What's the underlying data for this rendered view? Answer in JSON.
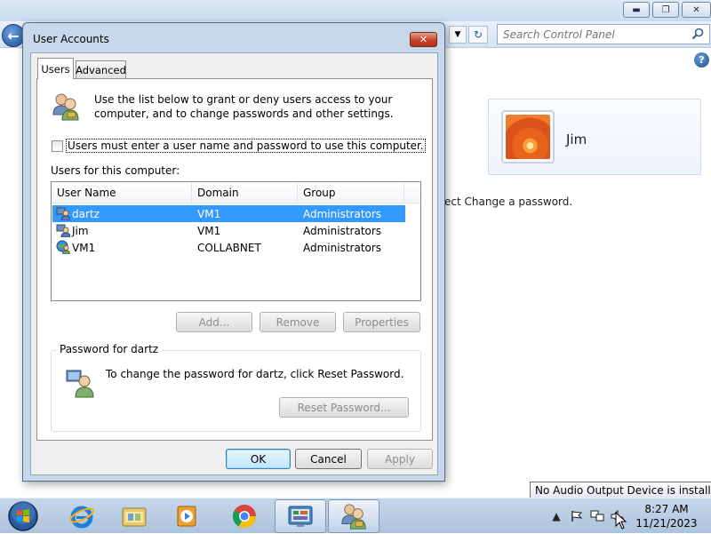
{
  "control_panel": {
    "search_placeholder": "Search Control Panel",
    "user_card_name": "Jim",
    "hint_text": "ect Change a password.",
    "help_label": "?",
    "back_label": "←"
  },
  "dialog": {
    "title": "User Accounts",
    "close_label": "✕",
    "tabs": [
      {
        "label": "Users",
        "selected": true
      },
      {
        "label": "Advanced",
        "selected": false
      }
    ],
    "intro_text": "Use the list below to grant or deny users access to your computer, and to change passwords and other settings.",
    "must_login_label": "Users must enter a user name and password to use this computer.",
    "must_login_checked": false,
    "users_label": "Users for this computer:",
    "columns": [
      "User Name",
      "Domain",
      "Group"
    ],
    "users": [
      {
        "name": "dartz",
        "domain": "VM1",
        "group": "Administrators",
        "selected": true
      },
      {
        "name": "Jim",
        "domain": "VM1",
        "group": "Administrators",
        "selected": false
      },
      {
        "name": "VM1",
        "domain": "COLLABNET",
        "group": "Administrators",
        "selected": false
      }
    ],
    "buttons": {
      "add": "Add...",
      "remove": "Remove",
      "properties": "Properties",
      "reset_password": "Reset Password...",
      "ok": "OK",
      "cancel": "Cancel",
      "apply": "Apply"
    },
    "password_group": {
      "legend": "Password for dartz",
      "text": "To change the password for dartz, click Reset Password."
    }
  },
  "taskbar": {
    "time": "8:27 AM",
    "date": "11/21/2023",
    "tooltip": "No Audio Output Device is installed."
  },
  "colors": {
    "selection": "#3399ff",
    "title_bar": "#c8d8ea",
    "taskbar": "#b9cde4"
  }
}
